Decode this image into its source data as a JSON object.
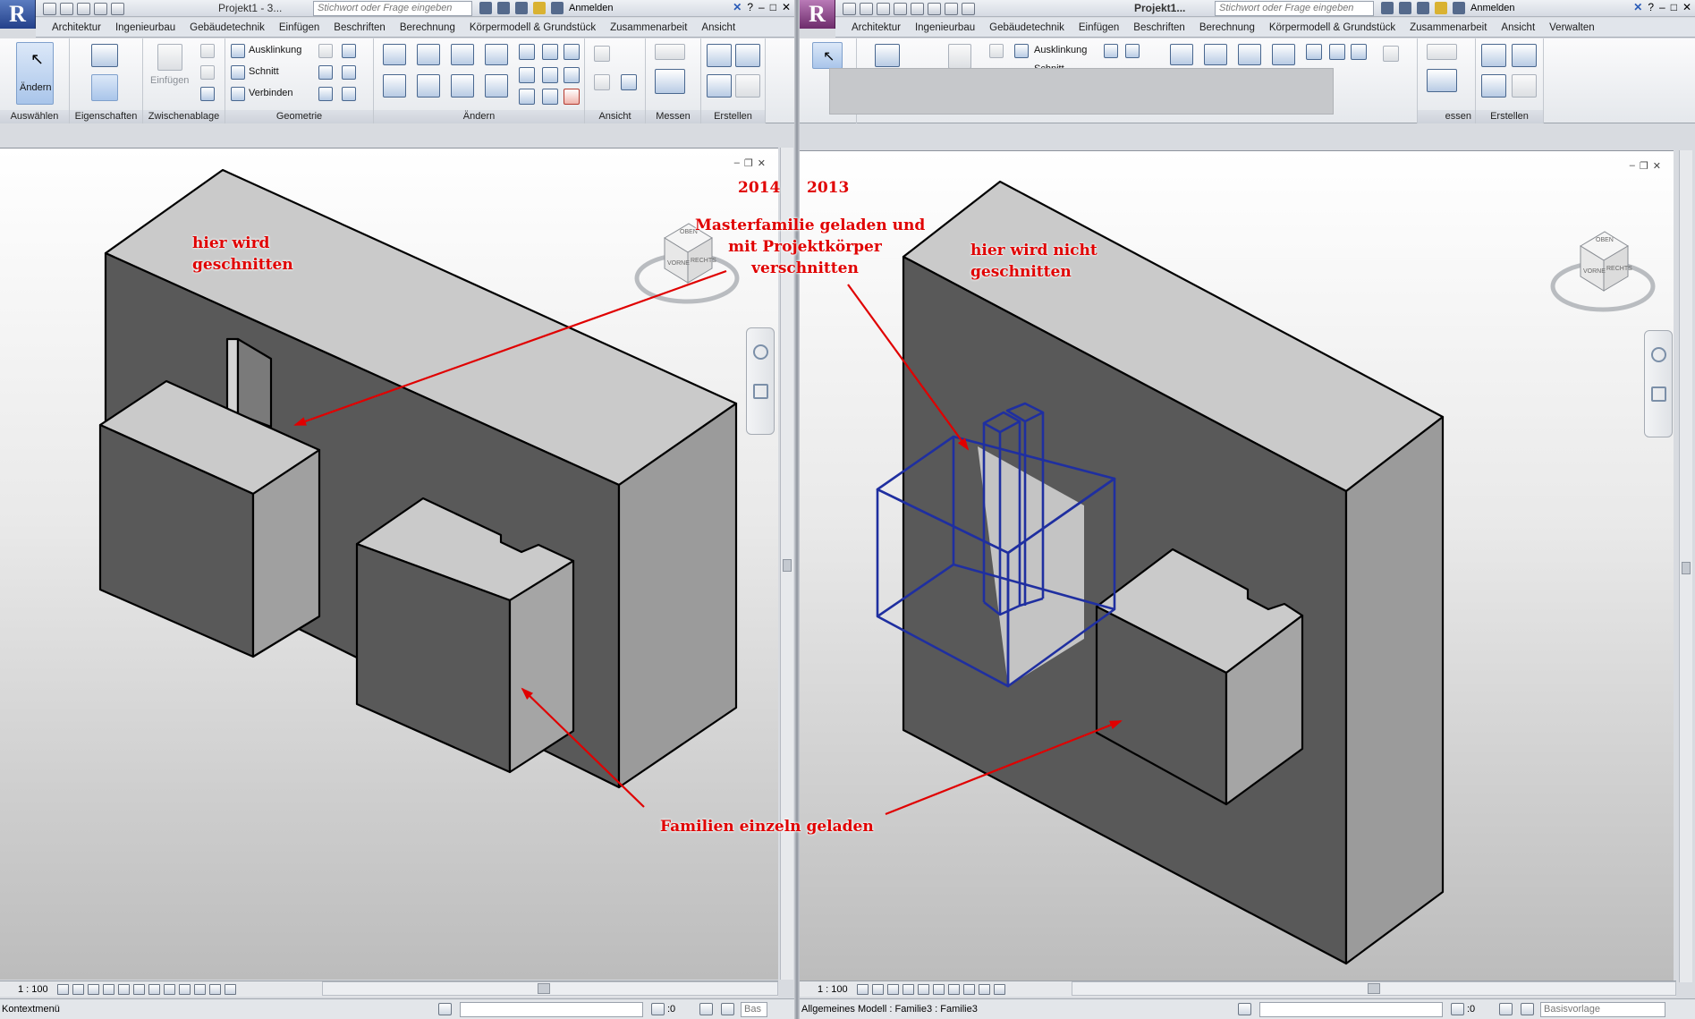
{
  "left_window": {
    "app_letter": "R",
    "title": "Projekt1 - 3...",
    "search_placeholder": "Stichwort oder Frage eingeben",
    "signin": "Anmelden",
    "tabs": [
      "Architektur",
      "Ingenieurbau",
      "Gebäudetechnik",
      "Einfügen",
      "Beschriften",
      "Berechnung",
      "Körpermodell & Grundstück",
      "Zusammenarbeit",
      "Ansicht"
    ],
    "ribbon": {
      "modify_label": "Ändern",
      "paste_label": "Einfügen",
      "cope_label": "Ausklinkung",
      "cut_label": "Schnitt",
      "join_label": "Verbinden",
      "panels": [
        "Auswählen",
        "Eigenschaften",
        "Zwischenablage",
        "Geometrie",
        "Ändern",
        "Ansicht",
        "Messen",
        "Erstellen"
      ]
    },
    "viewcube": {
      "top": "OBEN",
      "front": "VORNE",
      "right": "RECHTS"
    },
    "scale": "1 : 100",
    "status_text": "Kontextmenü",
    "status_zero": ":0",
    "status_field": "Bas"
  },
  "right_window": {
    "app_letter": "R",
    "title": "Projekt1...",
    "search_placeholder": "Stichwort oder Frage eingeben",
    "signin": "Anmelden",
    "tabs": [
      "Architektur",
      "Ingenieurbau",
      "Gebäudetechnik",
      "Einfügen",
      "Beschriften",
      "Berechnung",
      "Körpermodell & Grundstück",
      "Zusammenarbeit",
      "Ansicht",
      "Verwalten"
    ],
    "ribbon": {
      "cope_label": "Ausklinkung",
      "cut_label": "Schnitt",
      "panels": [
        "essen",
        "Erstellen"
      ]
    },
    "viewcube": {
      "top": "OBEN",
      "front": "VORNE",
      "right": "RECHTS"
    },
    "scale": "1 : 100",
    "status_text": "Allgemeines Modell : Familie3 : Familie3",
    "status_zero": ":0",
    "status_field": "Basisvorlage"
  },
  "annotations": {
    "left_cut": [
      "hier wird",
      "geschnitten"
    ],
    "year_2014": "2014",
    "year_2013": "2013",
    "master": [
      "Masterfamilie geladen und",
      "mit Projektkörper",
      "verschnitten"
    ],
    "right_nocut": [
      "hier wird nicht",
      "geschnitten"
    ],
    "families": "Familien einzeln geladen"
  },
  "colors": {
    "annotation_red": "#e00000",
    "selection_blue": "#1f2fa0",
    "face_dark": "#5b5b5b",
    "face_light": "#c9c9c9",
    "face_mid": "#9a9a9a"
  }
}
